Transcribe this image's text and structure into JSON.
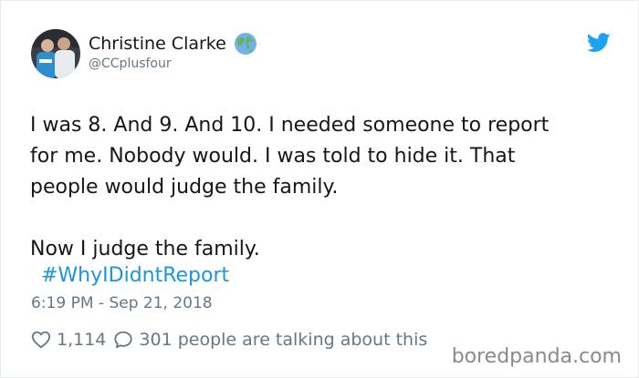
{
  "author": {
    "display_name": "Christine Clarke",
    "handle": "@CCplusfour",
    "verified_badge_icon": "globe-emoji-icon"
  },
  "tweet": {
    "lines": [
      "I was 8.  And 9. And 10.  I needed someone to report",
      "for me.  Nobody would.  I was told to hide it.  That",
      "people would judge the family."
    ],
    "second_paragraph": "Now I judge the family.",
    "hashtag": "#WhyIDidntReport",
    "timestamp": "6:19 PM - Sep 21, 2018"
  },
  "engagement": {
    "likes": "1,114",
    "talking": "301 people are talking about this"
  },
  "watermark": "boredpanda.com",
  "colors": {
    "text": "#14171a",
    "muted": "#657786",
    "link": "#1b95e0",
    "twitter_blue": "#1da1f2"
  }
}
